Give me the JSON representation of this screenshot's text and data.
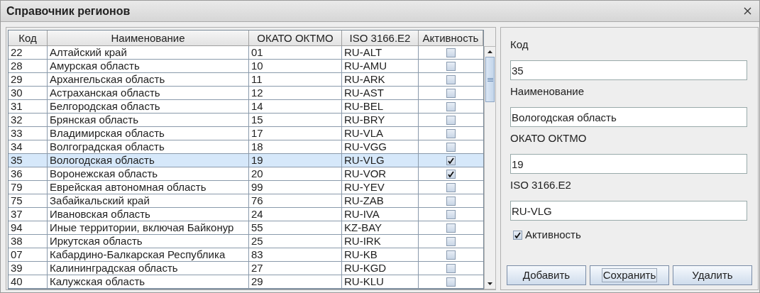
{
  "window": {
    "title": "Справочник регионов"
  },
  "table": {
    "columns": [
      "Код",
      "Наименование",
      "ОКАТО ОКТМО",
      "ISO 3166.E2",
      "Активность"
    ],
    "rows": [
      {
        "code": "22",
        "name": "Алтайский край",
        "okato": "01",
        "iso": "RU-ALT",
        "active": false,
        "selected": false
      },
      {
        "code": "28",
        "name": "Амурская область",
        "okato": "10",
        "iso": "RU-AMU",
        "active": false,
        "selected": false
      },
      {
        "code": "29",
        "name": "Архангельская область",
        "okato": "11",
        "iso": "RU-ARK",
        "active": false,
        "selected": false
      },
      {
        "code": "30",
        "name": "Астраханская область",
        "okato": "12",
        "iso": "RU-AST",
        "active": false,
        "selected": false
      },
      {
        "code": "31",
        "name": "Белгородская область",
        "okato": "14",
        "iso": "RU-BEL",
        "active": false,
        "selected": false
      },
      {
        "code": "32",
        "name": "Брянская область",
        "okato": "15",
        "iso": "RU-BRY",
        "active": false,
        "selected": false
      },
      {
        "code": "33",
        "name": "Владимирская область",
        "okato": "17",
        "iso": "RU-VLA",
        "active": false,
        "selected": false
      },
      {
        "code": "34",
        "name": "Волгоградская область",
        "okato": "18",
        "iso": "RU-VGG",
        "active": false,
        "selected": false
      },
      {
        "code": "35",
        "name": "Вологодская область",
        "okato": "19",
        "iso": "RU-VLG",
        "active": true,
        "selected": true
      },
      {
        "code": "36",
        "name": "Воронежская область",
        "okato": "20",
        "iso": "RU-VOR",
        "active": true,
        "selected": false
      },
      {
        "code": "79",
        "name": "Еврейская автономная область",
        "okato": "99",
        "iso": "RU-YEV",
        "active": false,
        "selected": false
      },
      {
        "code": "75",
        "name": "Забайкальский край",
        "okato": "76",
        "iso": "RU-ZAB",
        "active": false,
        "selected": false
      },
      {
        "code": "37",
        "name": "Ивановская область",
        "okato": "24",
        "iso": "RU-IVA",
        "active": false,
        "selected": false
      },
      {
        "code": "94",
        "name": "Иные территории, включая Байконур",
        "okato": "55",
        "iso": "KZ-BAY",
        "active": false,
        "selected": false
      },
      {
        "code": "38",
        "name": "Иркутская область",
        "okato": "25",
        "iso": "RU-IRK",
        "active": false,
        "selected": false
      },
      {
        "code": "07",
        "name": "Кабардино-Балкарская Республика",
        "okato": "83",
        "iso": "RU-KB",
        "active": false,
        "selected": false
      },
      {
        "code": "39",
        "name": "Калининградская область",
        "okato": "27",
        "iso": "RU-KGD",
        "active": false,
        "selected": false
      },
      {
        "code": "40",
        "name": "Калужская область",
        "okato": "29",
        "iso": "RU-KLU",
        "active": false,
        "selected": false
      }
    ]
  },
  "form": {
    "fields": [
      {
        "label": "Код",
        "value": "35"
      },
      {
        "label": "Наименование",
        "value": "Вологодская область"
      },
      {
        "label": "ОКАТО ОКТМО",
        "value": "19"
      },
      {
        "label": "ISO 3166.E2",
        "value": "RU-VLG"
      }
    ],
    "active": {
      "label": "Активность",
      "checked": true
    },
    "buttons": [
      {
        "label": "Добавить",
        "focused": false
      },
      {
        "label": "Сохранить",
        "focused": true
      },
      {
        "label": "Удалить",
        "focused": false
      }
    ]
  }
}
